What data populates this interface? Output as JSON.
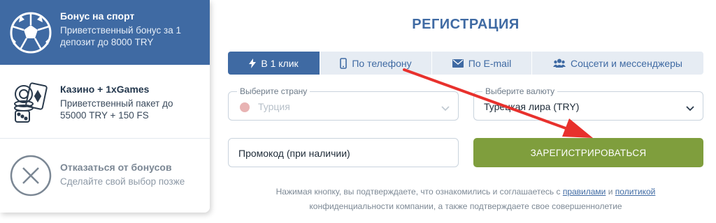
{
  "bonuses": {
    "sport": {
      "title": "Бонус на спорт",
      "desc": "Приветственный бонус за 1 депозит до 8000 TRY",
      "icon": "soccer-ball-icon"
    },
    "casino": {
      "title": "Казино + 1xGames",
      "desc": "Приветственный пакет до 55000 TRY + 150 FS",
      "icon": "casino-chips-cards-icon"
    },
    "decline": {
      "title": "Отказаться от бонусов",
      "desc": "Сделайте свой выбор позже",
      "icon": "close-circle-icon"
    }
  },
  "form": {
    "title": "РЕГИСТРАЦИЯ",
    "tabs": [
      {
        "label": "В 1 клик",
        "icon": "lightning-icon",
        "active": true
      },
      {
        "label": "По телефону",
        "icon": "phone-icon"
      },
      {
        "label": "По E-mail",
        "icon": "envelope-icon"
      },
      {
        "label": "Соцсети и мессенджеры",
        "icon": "users-icon"
      }
    ],
    "country": {
      "label": "Выберите страну",
      "value": "Турция"
    },
    "currency": {
      "label": "Выберите валюту",
      "value": "Турецкая лира (TRY)"
    },
    "promo": {
      "placeholder": "Промокод (при наличии)"
    },
    "register_label": "ЗАРЕГИСТРИРОВАТЬСЯ",
    "disclaimer": {
      "before": "Нажимая кнопку, вы подтверждаете, что ознакомились и соглашаетесь с",
      "rules_link": "правилами",
      "and": "и",
      "policy_link": "политикой",
      "after": "конфиденциальности компании, а также подтверждаете свое совершеннолетие"
    }
  },
  "colors": {
    "brand_blue": "#3f6aa3",
    "register_green": "#7f9e3d",
    "arrow_red": "#e8312d"
  }
}
